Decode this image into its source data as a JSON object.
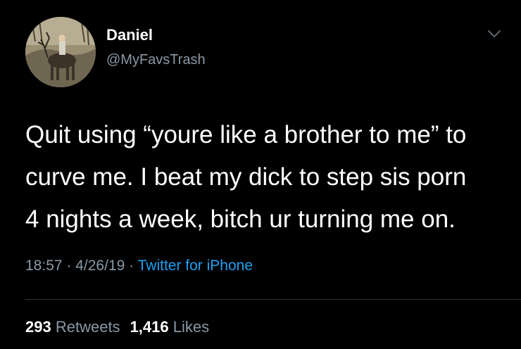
{
  "user": {
    "display_name": "Daniel",
    "handle": "@MyFavsTrash",
    "avatar_icon": "avatar-photo-deer-rider"
  },
  "tweet": {
    "lines": [
      "Quit using “youre like a brother to me” to",
      "curve me. I beat my dick to step sis porn",
      "4 nights a week, bitch ur turning me on."
    ]
  },
  "meta": {
    "time": "18:57",
    "separator": " · ",
    "date": "4/26/19",
    "separator2": " · ",
    "source": "Twitter for iPhone"
  },
  "stats": {
    "retweets_count": "293",
    "retweets_label": "Retweets",
    "likes_count": "1,416",
    "likes_label": "Likes"
  },
  "menu_icon": "chevron-down-icon",
  "colors": {
    "background": "#000000",
    "primary_text": "#ffffff",
    "secondary_text": "#8899a6",
    "link": "#1da1f2"
  }
}
